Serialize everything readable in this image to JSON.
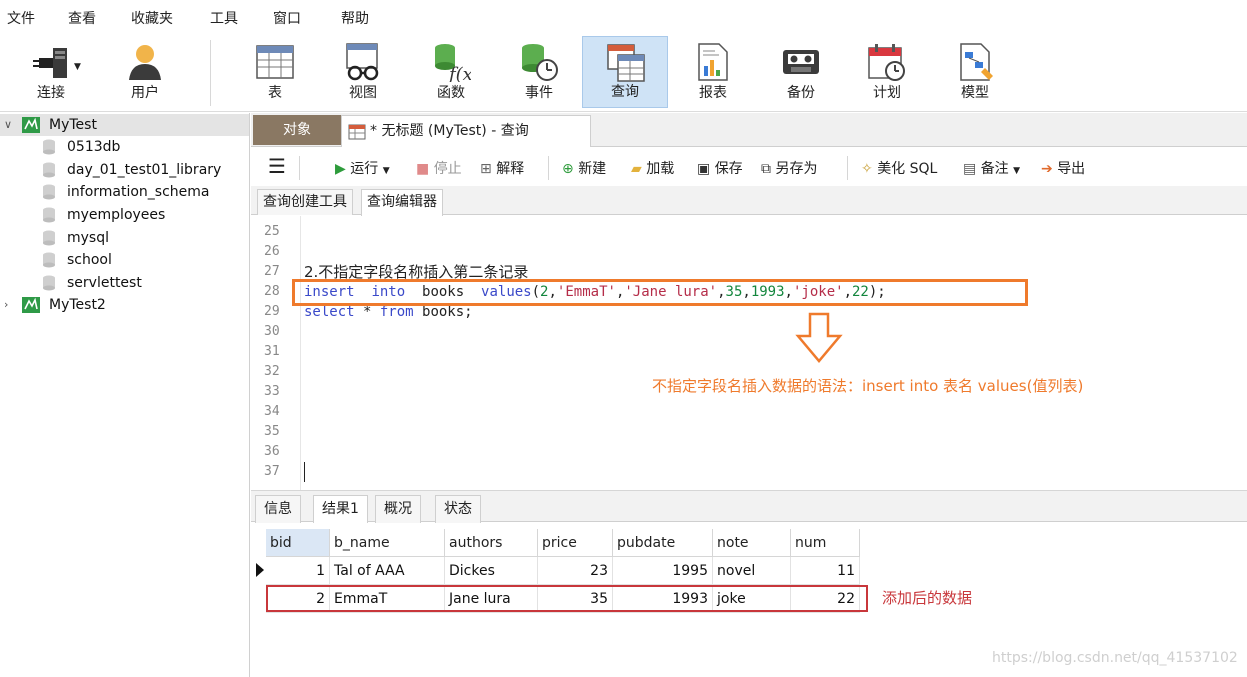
{
  "menu": [
    "文件",
    "查看",
    "收藏夹",
    "工具",
    "窗口",
    "帮助"
  ],
  "toolbar": {
    "items": [
      {
        "label": "连接",
        "icon": "plug-connect-icon"
      },
      {
        "label": "用户",
        "icon": "user-icon"
      },
      {
        "label": "表",
        "icon": "table-icon"
      },
      {
        "label": "视图",
        "icon": "view-glasses-icon"
      },
      {
        "label": "函数",
        "icon": "function-icon"
      },
      {
        "label": "事件",
        "icon": "event-clock-icon"
      },
      {
        "label": "查询",
        "icon": "query-icon",
        "active": true
      },
      {
        "label": "报表",
        "icon": "report-icon"
      },
      {
        "label": "备份",
        "icon": "backup-tape-icon"
      },
      {
        "label": "计划",
        "icon": "schedule-calendar-icon"
      },
      {
        "label": "模型",
        "icon": "model-diagram-icon"
      }
    ]
  },
  "tree": {
    "connections": [
      {
        "name": "MyTest",
        "expanded": true,
        "databases": [
          "0513db",
          "day_01_test01_library",
          "information_schema",
          "myemployees",
          "mysql",
          "school",
          "servlettest"
        ]
      },
      {
        "name": "MyTest2",
        "expanded": false
      }
    ]
  },
  "tabs": {
    "objects": "对象",
    "query": "* 无标题 (MyTest) - 查询"
  },
  "query_toolbar": {
    "run": "运行",
    "stop": "停止",
    "explain": "解释",
    "new": "新建",
    "load": "加载",
    "save": "保存",
    "save_as": "另存为",
    "beautify": "美化 SQL",
    "comment": "备注",
    "export": "导出"
  },
  "subtabs": [
    "查询创建工具",
    "查询编辑器"
  ],
  "editor": {
    "line_numbers": [
      "25",
      "26",
      "27",
      "28",
      "29",
      "30",
      "31",
      "32",
      "33",
      "34",
      "35",
      "36",
      "37"
    ],
    "line27": "2.不指定字段名称插入第二条记录",
    "line28": {
      "kw1": "insert",
      "kw2": "into",
      "table": "books",
      "kw3": "values",
      "open": "(",
      "v1": "2",
      "v2": "'EmmaT'",
      "v3": "'Jane lura'",
      "v4": "35",
      "v5": "1993",
      "v6": "'joke'",
      "v7": "22",
      "close": ");"
    },
    "line29": {
      "kw1": "select",
      "star": " * ",
      "kw2": "from",
      "table": " books;"
    }
  },
  "annotation": "不指定字段名插入数据的语法：insert into 表名  values(值列表)",
  "result_tabs": [
    "信息",
    "结果1",
    "概况",
    "状态"
  ],
  "result": {
    "columns": [
      "bid",
      "b_name",
      "authors",
      "price",
      "pubdate",
      "note",
      "num"
    ],
    "rows": [
      [
        "1",
        "Tal of AAA",
        "Dickes",
        "23",
        "1995",
        "novel",
        "11"
      ],
      [
        "2",
        "EmmaT",
        "Jane lura",
        "35",
        "1993",
        "joke",
        "22"
      ]
    ]
  },
  "row_note": "添加后的数据",
  "watermark": "https://blog.csdn.net/qq_41537102",
  "colors": {
    "accent_orange": "#ef7a2c",
    "accent_red": "#c8373b",
    "keyword": "#3a49c9",
    "string": "#b52d49",
    "number": "#13863d",
    "objects_tab": "#8a7863"
  }
}
